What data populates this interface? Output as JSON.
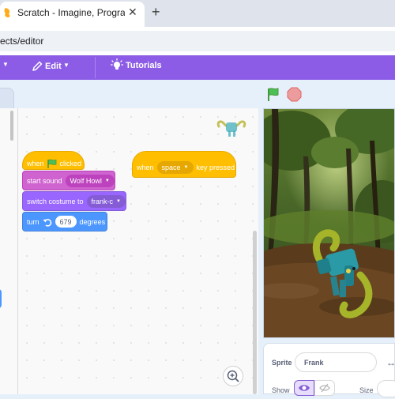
{
  "browser": {
    "tab_title": "Scratch - Imagine, Program, Sh",
    "tab_close": "✕",
    "new_tab": "+",
    "address": "ects/editor"
  },
  "menubar": {
    "caret": "▼",
    "edit_label": "Edit",
    "tutorials_label": "Tutorials"
  },
  "scripts": {
    "hat1": {
      "when": "when",
      "clicked": "clicked"
    },
    "sound": {
      "label": "start sound",
      "value": "Wolf Howl"
    },
    "costume": {
      "label": "switch costume to",
      "value": "frank-c"
    },
    "turn": {
      "label": "turn",
      "value": "679",
      "unit": "degrees"
    },
    "hat2": {
      "when": "when",
      "key": "space",
      "suffix": "key pressed"
    }
  },
  "sprite_info": {
    "sprite_label": "Sprite",
    "sprite_name": "Frank",
    "x_arrow": "↔",
    "show_label": "Show",
    "size_label": "Size"
  },
  "colors": {
    "menubar": "#8c5ce6",
    "events": "#ffbf00",
    "sound": "#cf63cf",
    "looks": "#9966ff",
    "motion": "#4c97ff"
  }
}
